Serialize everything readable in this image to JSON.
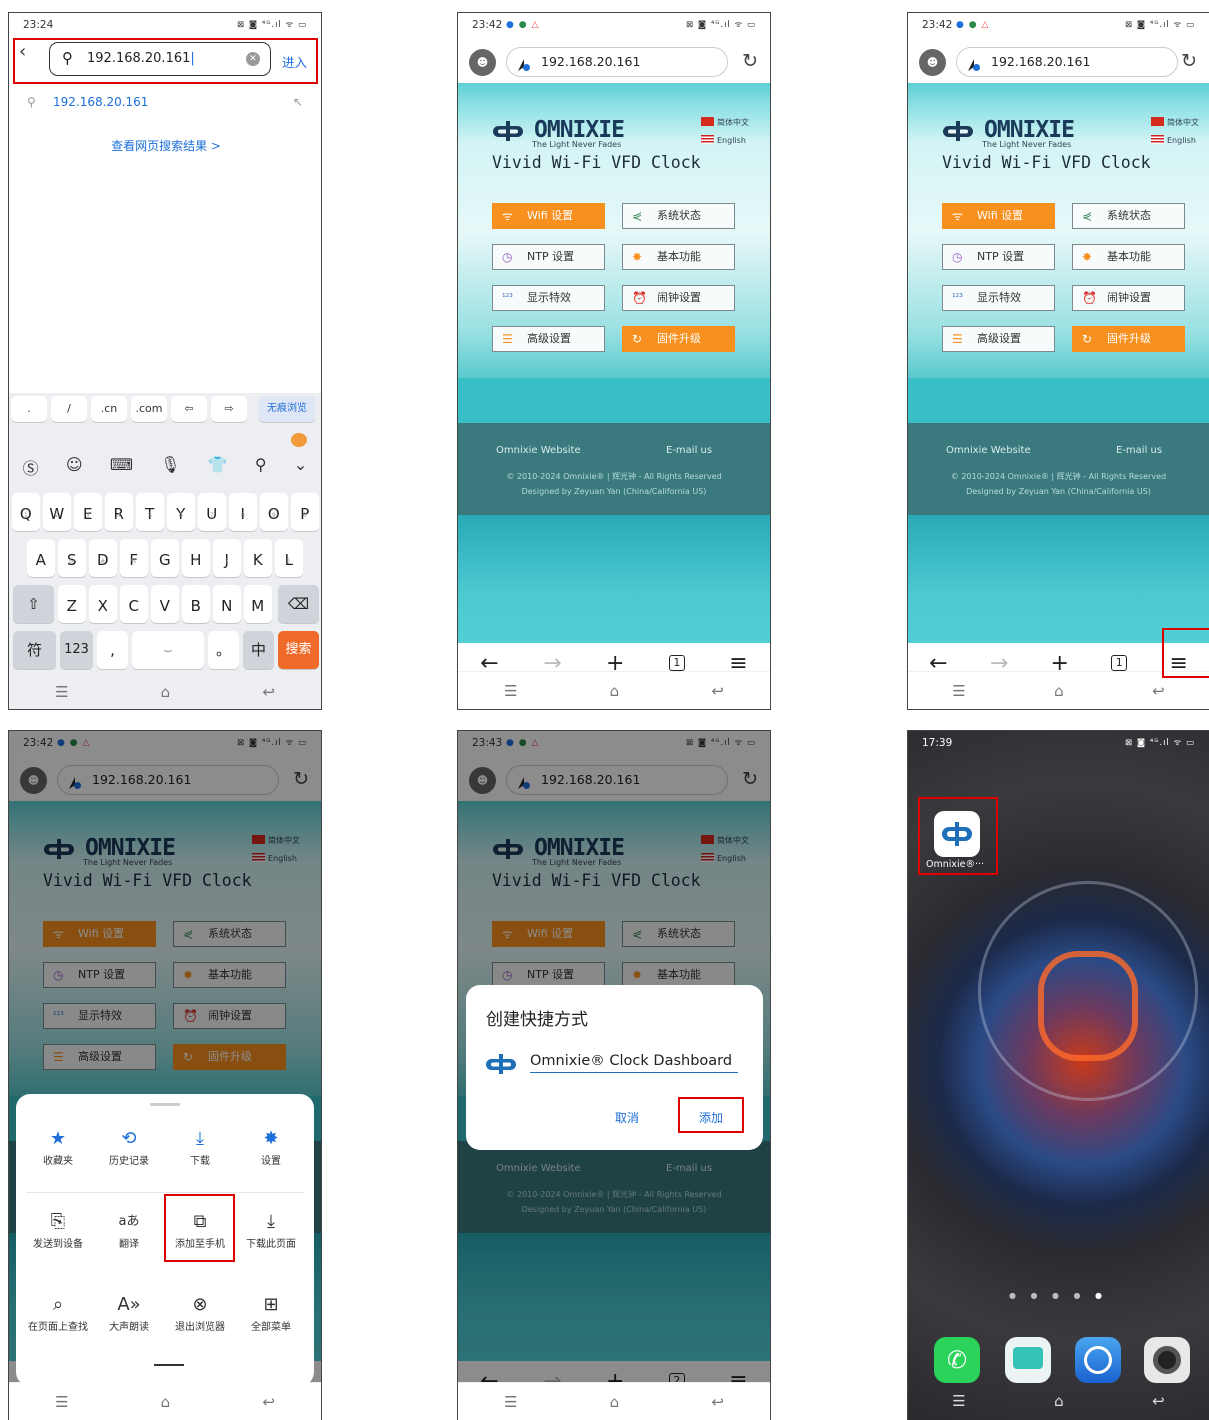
{
  "p1": {
    "time": "23:24",
    "status": "⊠ ◙ ⁴ᴳ.ıl ᯤ ▭",
    "url": "192.168.20.161",
    "go": "进入",
    "suggest": "192.168.20.161",
    "search_results": "查看网页搜索结果 >",
    "quick": [
      ".",
      "/",
      ".cn",
      ".com",
      "⇦",
      "⇨",
      "无痕浏览"
    ],
    "row1": [
      [
        "Q",
        "1"
      ],
      [
        "W",
        "2"
      ],
      [
        "E",
        "3"
      ],
      [
        "R",
        "4"
      ],
      [
        "T",
        "5"
      ],
      [
        "Y",
        "6"
      ],
      [
        "U",
        "7"
      ],
      [
        "I",
        "8"
      ],
      [
        "O",
        "9"
      ],
      [
        "P",
        "0"
      ]
    ],
    "row2": [
      [
        "A",
        "!"
      ],
      [
        "S",
        "@"
      ],
      [
        "D",
        "#"
      ],
      [
        "F",
        "%"
      ],
      [
        "G",
        "\""
      ],
      [
        "H",
        "*"
      ],
      [
        "J",
        "?"
      ],
      [
        "K",
        "("
      ],
      [
        "L",
        ")"
      ]
    ],
    "row3": [
      [
        "Z",
        "~"
      ],
      [
        "X",
        ""
      ],
      [
        "C",
        ""
      ],
      [
        "V",
        ""
      ],
      [
        "B",
        ""
      ],
      [
        "N",
        ""
      ],
      [
        "M",
        ""
      ]
    ],
    "sym": "符",
    "num": "123",
    "comma": ",",
    "period": "。",
    "zh": "中",
    "search": "搜索"
  },
  "browser": {
    "url": "192.168.20.161",
    "brand": "OMNIXIE",
    "tagline": "The Light Never Fades",
    "title": "Vivid Wi-Fi VFD Clock",
    "lang_cn": "简体中文",
    "lang_en": "English",
    "buttons": [
      "Wifi 设置",
      "系统状态",
      "NTP 设置",
      "基本功能",
      "显示特效",
      "闹钟设置",
      "高级设置",
      "固件升级"
    ],
    "footer_site": "Omnixie Website",
    "footer_email": "E-mail us",
    "copyright": "© 2010-2024 Omnixie® | 辉光钟 - All Rights Reserved",
    "designed": "Designed by Zeyuan Yan (China/California US)"
  },
  "p2": {
    "time": "23:42",
    "tabs": "1"
  },
  "p3": {
    "time": "23:42",
    "tabs": "1"
  },
  "p4": {
    "time": "23:42",
    "menu": [
      "收藏夹",
      "历史记录",
      "下载",
      "设置",
      "发送到设备",
      "翻译",
      "添加至手机",
      "下载此页面",
      "在页面上查找",
      "大声朗读",
      "退出浏览器",
      "全部菜单"
    ]
  },
  "p5": {
    "time": "23:43",
    "tabs": "2",
    "dialog_title": "创建快捷方式",
    "shortcut_name": "Omnixie® Clock Dashboard",
    "cancel": "取消",
    "add": "添加"
  },
  "p6": {
    "time": "17:39",
    "app_label": "Omnixie®···"
  }
}
